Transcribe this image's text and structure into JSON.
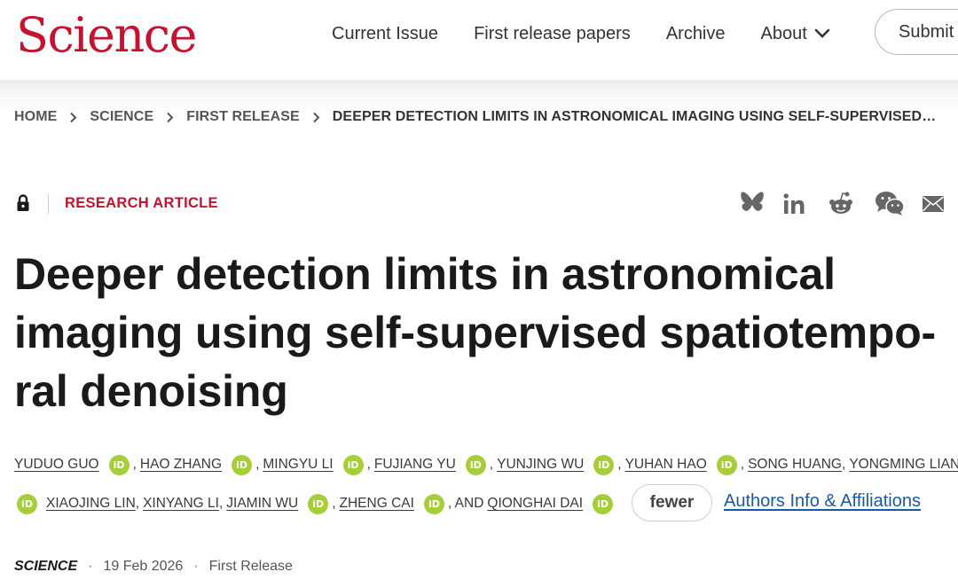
{
  "header": {
    "logo": "Science",
    "nav": [
      {
        "label": "Current Issue"
      },
      {
        "label": "First release papers"
      },
      {
        "label": "Archive"
      },
      {
        "label": "About"
      }
    ],
    "submit_label": "Submit"
  },
  "breadcrumb": {
    "items": [
      "HOME",
      "SCIENCE",
      "FIRST RELEASE"
    ],
    "current": "DEEPER DETECTION LIMITS IN ASTRONOMICAL IMAGING USING SELF-SUPERVISED…"
  },
  "article": {
    "type": "RESEARCH ARTICLE",
    "title": "Deeper detection limits in astronomical imaging using self-supervised spatiotempo-ral denoising",
    "authors_line1": [
      {
        "name": "YUDUO GUO",
        "orcid": true,
        "sep": ","
      },
      {
        "name": "HAO ZHANG",
        "orcid": true,
        "sep": ","
      },
      {
        "name": "MINGYU LI",
        "orcid": true,
        "sep": ","
      },
      {
        "name": "FUJIANG YU",
        "orcid": true,
        "sep": ","
      },
      {
        "name": "YUNJING WU",
        "orcid": true,
        "sep": ","
      },
      {
        "name": "YUHAN HAO",
        "orcid": true,
        "sep": ","
      },
      {
        "name": "SONG HUANG",
        "orcid": false,
        "sep": ","
      },
      {
        "name": "YONGMING LIANG",
        "orcid": false,
        "sep": ""
      }
    ],
    "authors_line2_lead_orcid": true,
    "authors_line2": [
      {
        "name": "XIAOJING LIN",
        "orcid": false,
        "sep": ","
      },
      {
        "name": "XINYANG LI",
        "orcid": false,
        "sep": ","
      },
      {
        "name": "JIAMIN WU",
        "orcid": true,
        "sep": ","
      },
      {
        "name": "ZHENG CAI",
        "orcid": true,
        "sep": ", AND"
      },
      {
        "name": "QIONGHAI DAI",
        "orcid": true,
        "sep": ""
      }
    ],
    "orcid_badge": "iD",
    "fewer_label": "fewer",
    "affiliations_label": "Authors Info & Affiliations",
    "journal": "SCIENCE",
    "date": "19 Feb 2026",
    "status": "First Release"
  },
  "share": [
    "bluesky-icon",
    "linkedin-icon",
    "reddit-icon",
    "wechat-icon",
    "email-icon"
  ],
  "colors": {
    "brand": "#c4122f",
    "orcid": "#a6ce39",
    "link": "#1b59a8"
  }
}
